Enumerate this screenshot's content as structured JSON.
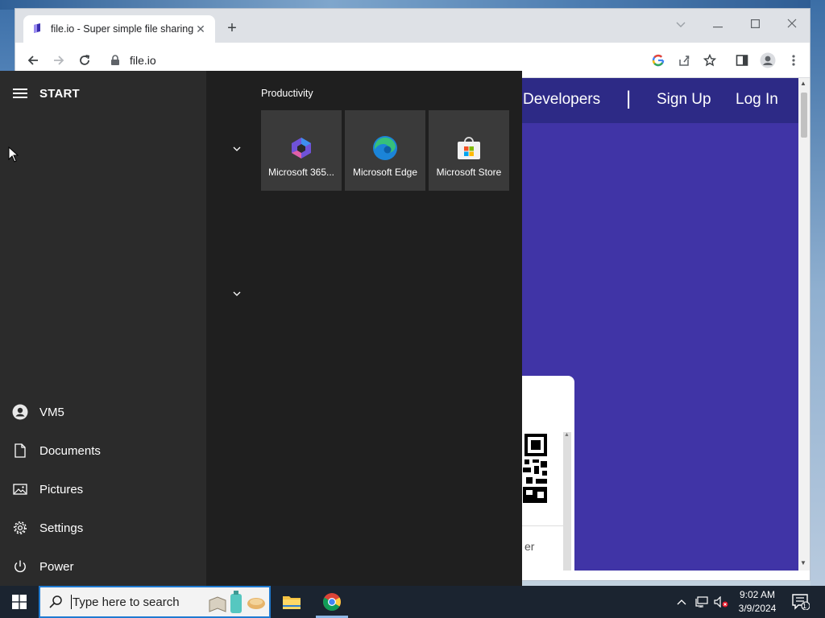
{
  "browser": {
    "tab_title": "file.io - Super simple file sharing",
    "address": "file.io",
    "nav_links": [
      "Developers",
      "|",
      "Sign Up",
      "Log In"
    ],
    "card_partial_text": "er"
  },
  "start_menu": {
    "title": "START",
    "group_label": "Productivity",
    "tiles": [
      {
        "label": "Microsoft 365...",
        "icon": "microsoft-365-icon"
      },
      {
        "label": "Microsoft Edge",
        "icon": "edge-icon"
      },
      {
        "label": "Microsoft Store",
        "icon": "store-icon"
      }
    ],
    "left_items": [
      {
        "label": "VM5",
        "icon": "user-icon"
      },
      {
        "label": "Documents",
        "icon": "document-icon"
      },
      {
        "label": "Pictures",
        "icon": "pictures-icon"
      },
      {
        "label": "Settings",
        "icon": "gear-icon"
      },
      {
        "label": "Power",
        "icon": "power-icon"
      }
    ]
  },
  "taskbar": {
    "search_placeholder": "Type here to search",
    "time": "9:02 AM",
    "date": "3/9/2024",
    "notification_count": "1"
  },
  "colors": {
    "page_nav": "#2d2a86",
    "page_body": "#4034a6",
    "start_left": "#2b2b2b",
    "start_mid": "#1f1f1f",
    "taskbar": "#1b2430",
    "search_border": "#1f7ad1"
  }
}
